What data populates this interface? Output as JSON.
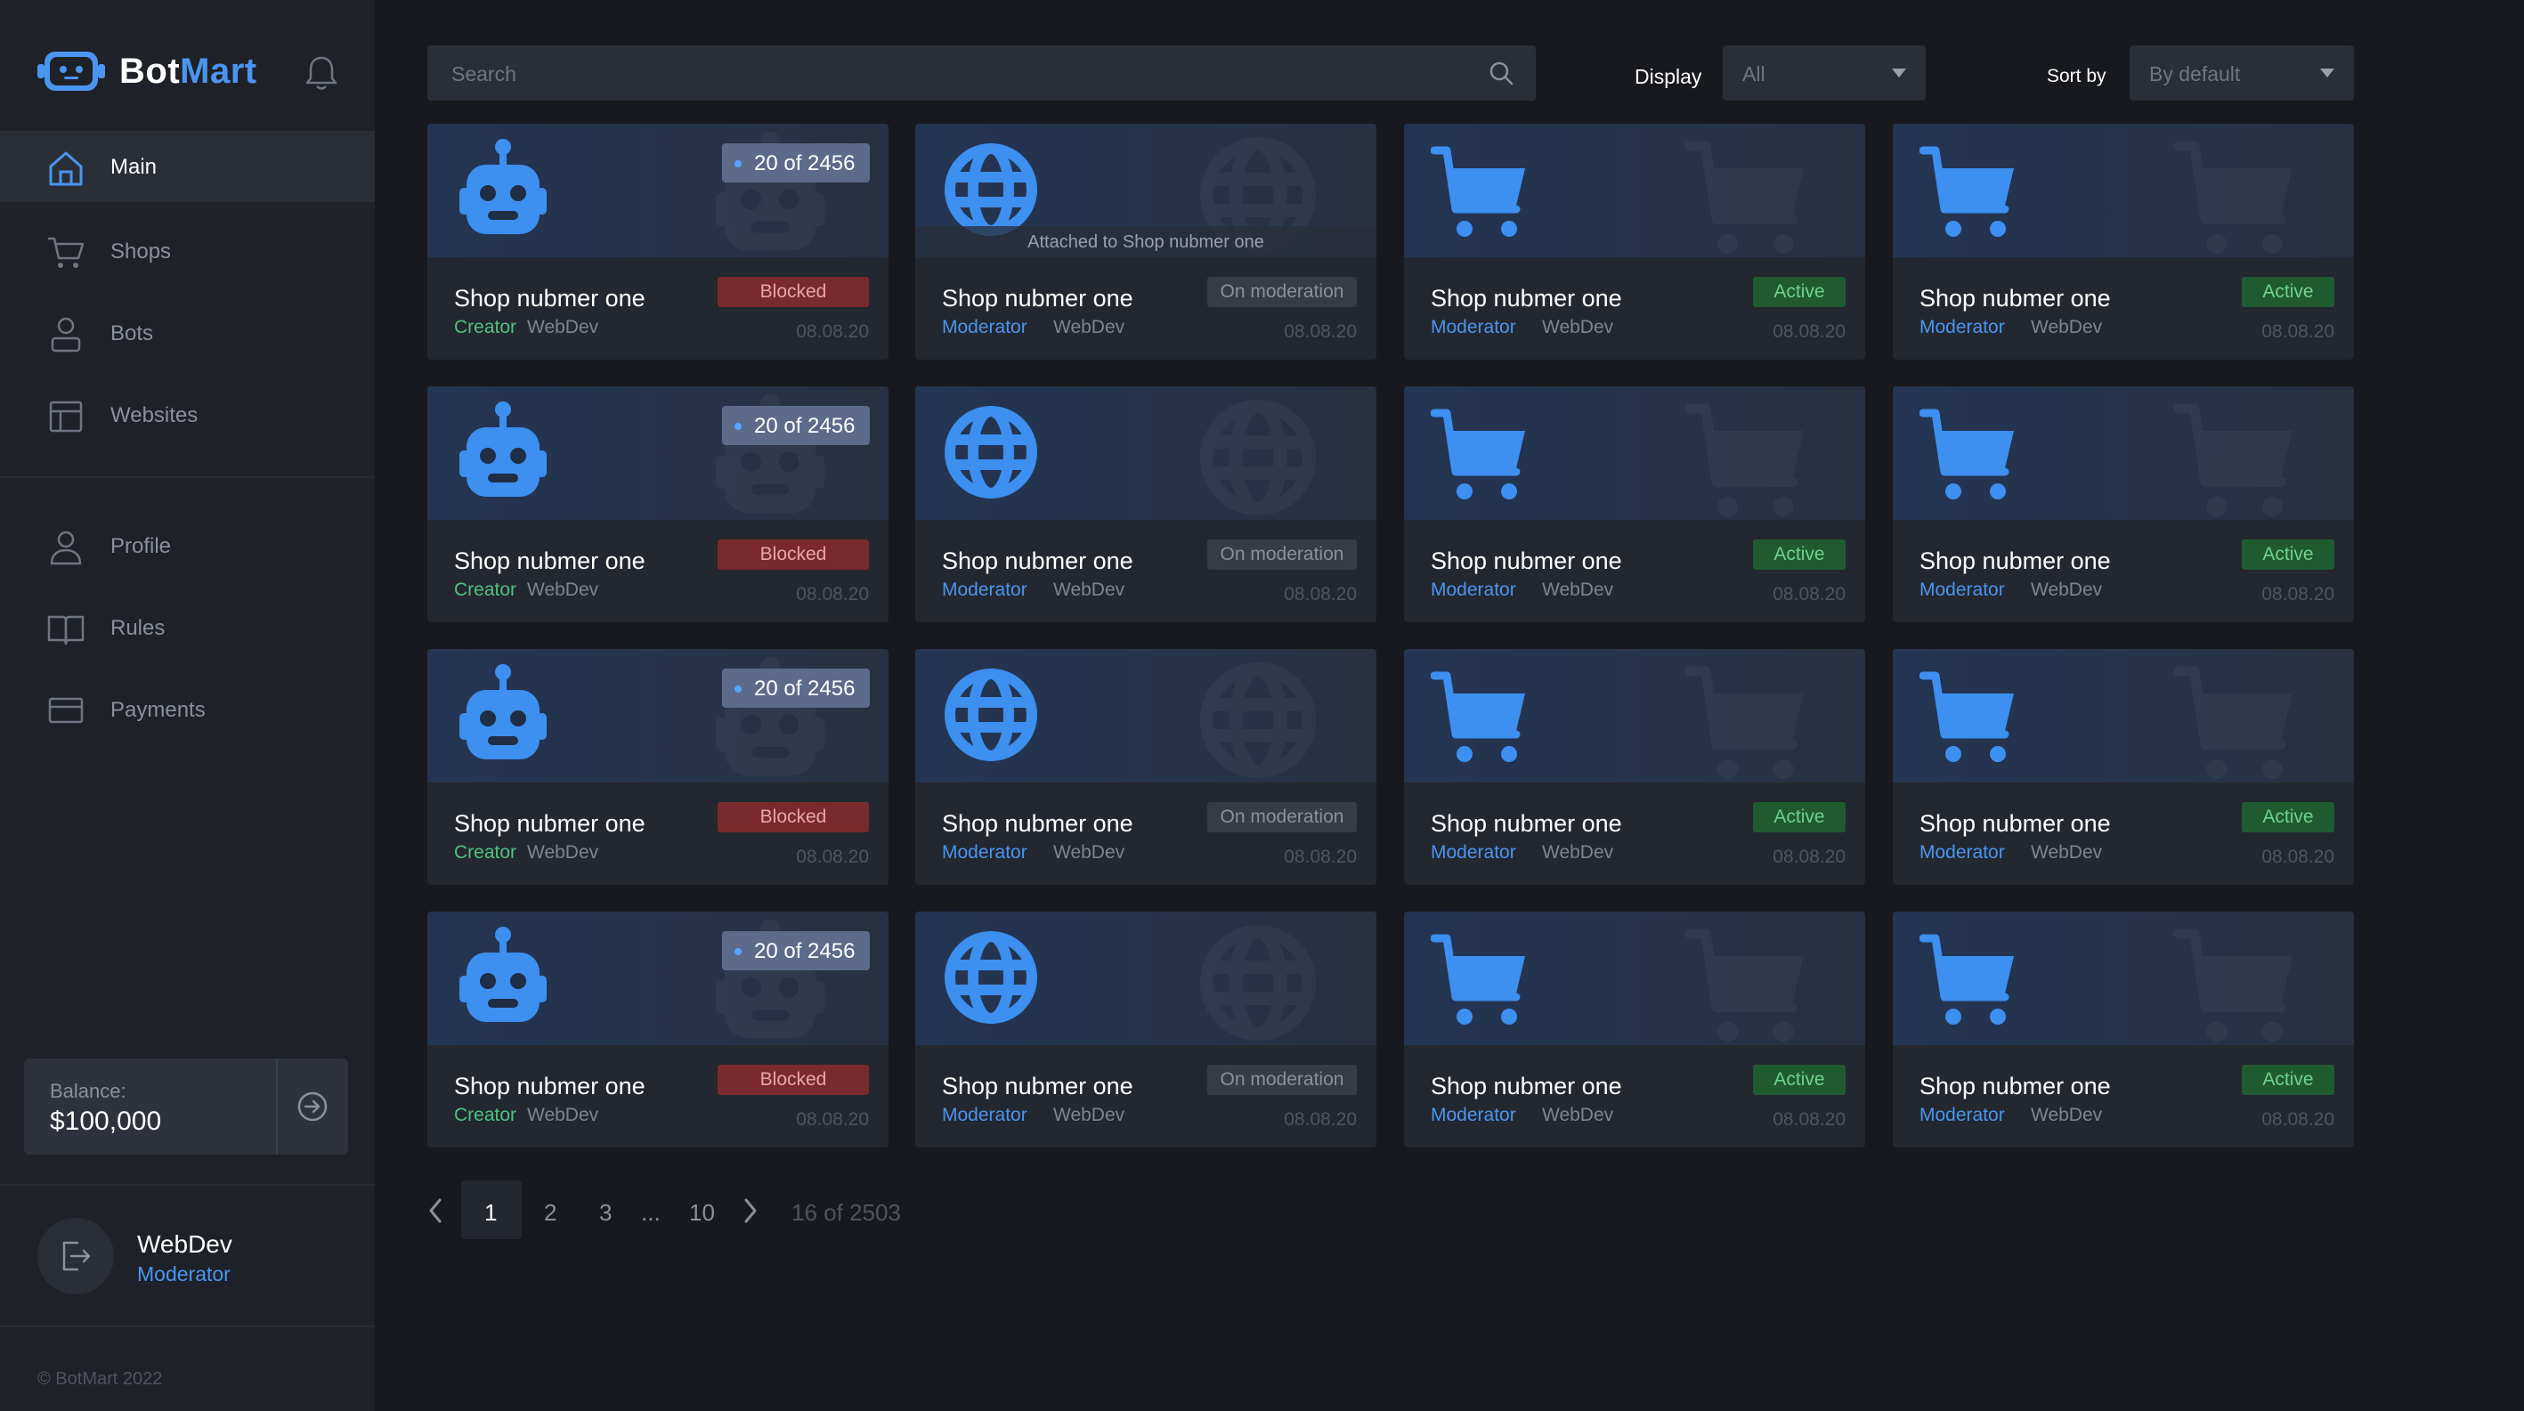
{
  "app": {
    "brand_part1": "Bot",
    "brand_part2": "Mart",
    "copyright": "© BotMart 2022"
  },
  "sidebar": {
    "items": [
      {
        "label": "Main",
        "icon": "home-icon",
        "active": true
      },
      {
        "label": "Shops",
        "icon": "cart-icon"
      },
      {
        "label": "Bots",
        "icon": "user-icon"
      },
      {
        "label": "Websites",
        "icon": "layout-icon"
      },
      {
        "label": "Profile",
        "icon": "profile-icon"
      },
      {
        "label": "Rules",
        "icon": "book-icon"
      },
      {
        "label": "Payments",
        "icon": "card-icon"
      }
    ],
    "balance_label": "Balance:",
    "balance_value": "$100,000",
    "user_name": "WebDev",
    "user_role": "Moderator"
  },
  "toolbar": {
    "search_placeholder": "Search",
    "display_label": "Display",
    "display_value": "All",
    "sort_label": "Sort by",
    "sort_value": "By default"
  },
  "cards": [
    {
      "type": "bot",
      "title": "Shop nubmer one",
      "role": "Creator",
      "owner": "WebDev",
      "status": "Blocked",
      "date": "08.08.20",
      "badge": "20 of 2456"
    },
    {
      "type": "website",
      "title": "Shop nubmer one",
      "role": "Moderator",
      "owner": "WebDev",
      "status": "On moderation",
      "date": "08.08.20",
      "attached": "Attached to Shop nubmer one"
    },
    {
      "type": "shop",
      "title": "Shop nubmer one",
      "role": "Moderator",
      "owner": "WebDev",
      "status": "Active",
      "date": "08.08.20"
    },
    {
      "type": "shop",
      "title": "Shop nubmer one",
      "role": "Moderator",
      "owner": "WebDev",
      "status": "Active",
      "date": "08.08.20"
    },
    {
      "type": "bot",
      "title": "Shop nubmer one",
      "role": "Creator",
      "owner": "WebDev",
      "status": "Blocked",
      "date": "08.08.20",
      "badge": "20 of 2456"
    },
    {
      "type": "website",
      "title": "Shop nubmer one",
      "role": "Moderator",
      "owner": "WebDev",
      "status": "On moderation",
      "date": "08.08.20"
    },
    {
      "type": "shop",
      "title": "Shop nubmer one",
      "role": "Moderator",
      "owner": "WebDev",
      "status": "Active",
      "date": "08.08.20"
    },
    {
      "type": "shop",
      "title": "Shop nubmer one",
      "role": "Moderator",
      "owner": "WebDev",
      "status": "Active",
      "date": "08.08.20"
    },
    {
      "type": "bot",
      "title": "Shop nubmer one",
      "role": "Creator",
      "owner": "WebDev",
      "status": "Blocked",
      "date": "08.08.20",
      "badge": "20 of 2456"
    },
    {
      "type": "website",
      "title": "Shop nubmer one",
      "role": "Moderator",
      "owner": "WebDev",
      "status": "On moderation",
      "date": "08.08.20"
    },
    {
      "type": "shop",
      "title": "Shop nubmer one",
      "role": "Moderator",
      "owner": "WebDev",
      "status": "Active",
      "date": "08.08.20"
    },
    {
      "type": "shop",
      "title": "Shop nubmer one",
      "role": "Moderator",
      "owner": "WebDev",
      "status": "Active",
      "date": "08.08.20"
    },
    {
      "type": "bot",
      "title": "Shop nubmer one",
      "role": "Creator",
      "owner": "WebDev",
      "status": "Blocked",
      "date": "08.08.20",
      "badge": "20 of 2456"
    },
    {
      "type": "website",
      "title": "Shop nubmer one",
      "role": "Moderator",
      "owner": "WebDev",
      "status": "On moderation",
      "date": "08.08.20"
    },
    {
      "type": "shop",
      "title": "Shop nubmer one",
      "role": "Moderator",
      "owner": "WebDev",
      "status": "Active",
      "date": "08.08.20"
    },
    {
      "type": "shop",
      "title": "Shop nubmer one",
      "role": "Moderator",
      "owner": "WebDev",
      "status": "Active",
      "date": "08.08.20"
    }
  ],
  "pagination": {
    "pages": [
      "1",
      "2",
      "3",
      "...",
      "10"
    ],
    "current": "1",
    "info": "16 of 2503"
  },
  "colors": {
    "accent": "#4a95f0",
    "creator": "#4fc281",
    "blocked": "#7a2a2c",
    "active": "#1f5b2f"
  }
}
